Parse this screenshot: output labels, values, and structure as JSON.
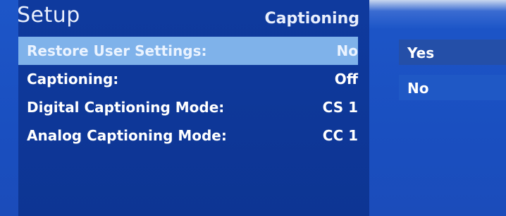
{
  "header": {
    "title": "Setup",
    "section": "Captioning"
  },
  "menu": {
    "items": [
      {
        "label": "Restore User Settings:",
        "value": "No"
      },
      {
        "label": "Captioning:",
        "value": "Off"
      },
      {
        "label": "Digital Captioning Mode:",
        "value": "CS 1"
      },
      {
        "label": "Analog Captioning Mode:",
        "value": "CC 1"
      }
    ],
    "selected_index": 0
  },
  "submenu": {
    "options": [
      "Yes",
      "No"
    ]
  },
  "colors": {
    "background": "#1a52c4",
    "panel": "#0f3a9e",
    "selected_row": "#7fb2ea"
  }
}
